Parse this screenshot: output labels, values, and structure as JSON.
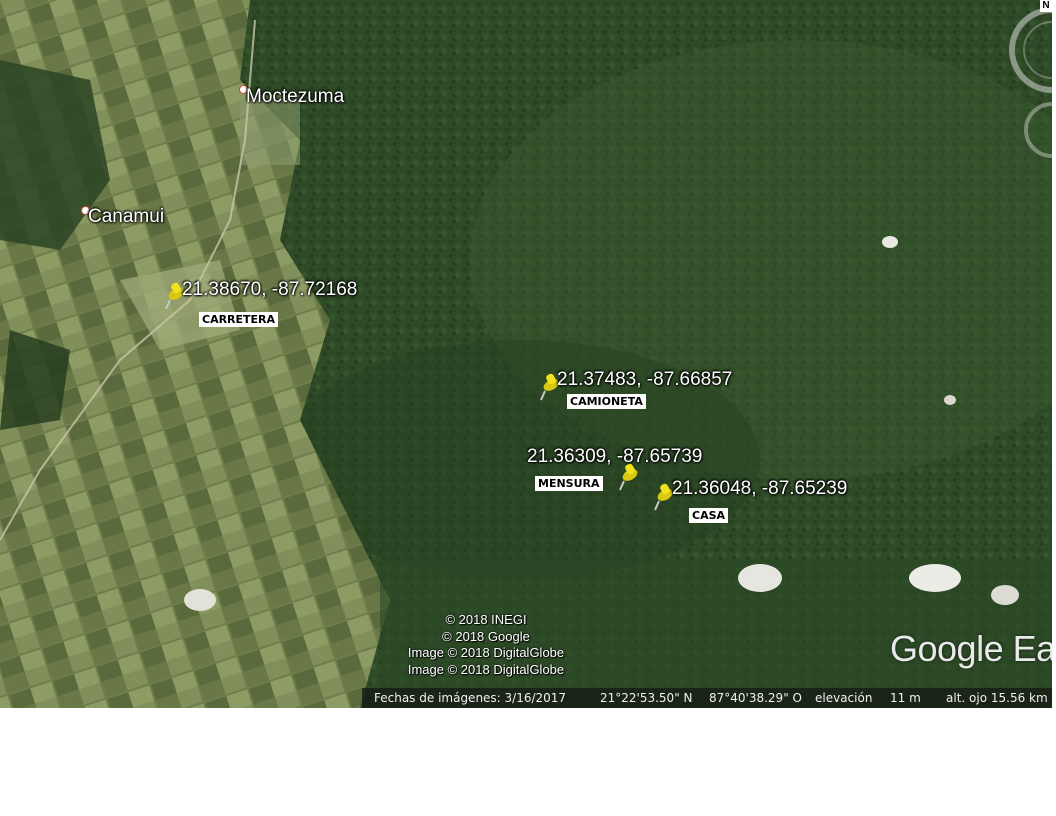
{
  "towns": [
    {
      "name": "Moctezuma"
    },
    {
      "name": "Canamui"
    }
  ],
  "placemarks": [
    {
      "coords": "21.38670, -87.72168",
      "label": "CARRETERA"
    },
    {
      "coords": "21.37483, -87.66857",
      "label": "CAMIONETA"
    },
    {
      "coords": "21.36309, -87.65739",
      "label": "MENSURA"
    },
    {
      "coords": "21.36048, -87.65239",
      "label": "CASA"
    }
  ],
  "credits": [
    "© 2018 INEGI",
    "© 2018 Google",
    "Image © 2018 DigitalGlobe",
    "Image © 2018 DigitalGlobe"
  ],
  "status": {
    "imagery_date": "Fechas de imágenes: 3/16/2017",
    "latitude": "21°22'53.50\" N",
    "longitude": "87°40'38.29\" O",
    "elevation_label": "elevación",
    "elevation": "11 m",
    "eye_alt": "alt. ojo  15.56 km"
  },
  "logo": "Google Earth",
  "compass": {
    "north": "N"
  },
  "colors": {
    "pin": "#f2e21c",
    "forest": "#2f4a27",
    "farmland": "#7f8f57"
  },
  "icons": [
    "pushpin-icon",
    "town-dot-icon",
    "compass-icon"
  ]
}
